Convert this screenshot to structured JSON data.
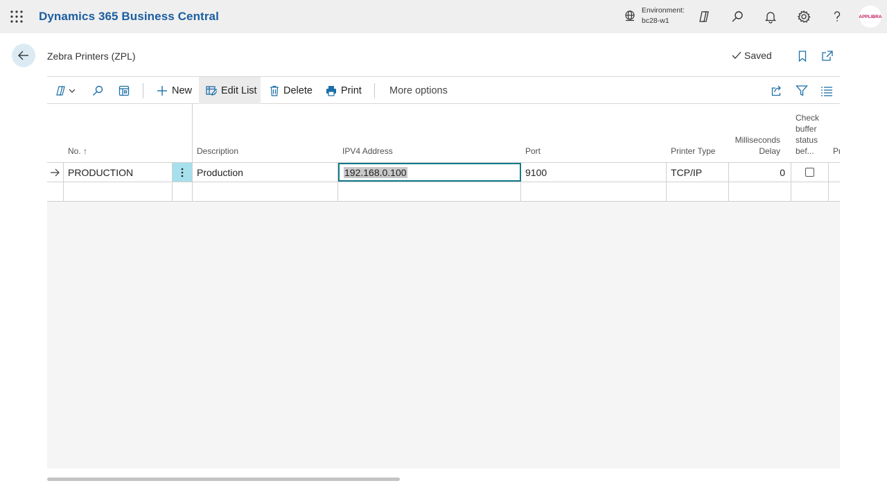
{
  "app": {
    "title": "Dynamics 365 Business Central",
    "environment_label": "Environment:",
    "environment_name": "bc28-w1",
    "avatar_text": "APPLIBRA"
  },
  "page": {
    "title": "Zebra Printers (ZPL)",
    "saved_label": "Saved"
  },
  "actions": {
    "new": "New",
    "edit_list": "Edit List",
    "delete": "Delete",
    "print": "Print",
    "more_options": "More options"
  },
  "columns": {
    "no": "No. ↑",
    "description": "Description",
    "ipv4": "IPV4 Address",
    "port": "Port",
    "printer_type": "Printer Type",
    "ms_delay_1": "Milliseconds",
    "ms_delay_2": "Delay",
    "check_1": "Check",
    "check_2": "buffer",
    "check_3": "status",
    "check_4": "bef...",
    "next": "Pr"
  },
  "rows": [
    {
      "no": "PRODUCTION",
      "description": "Production",
      "ipv4": "192.168.0.100",
      "port": "9100",
      "printer_type": "TCP/IP",
      "ms_delay": "0",
      "check_buffer": false
    }
  ],
  "colors": {
    "brand": "#1b5ea0",
    "focus": "#117b8a",
    "row_menu": "#a6e0ec"
  }
}
